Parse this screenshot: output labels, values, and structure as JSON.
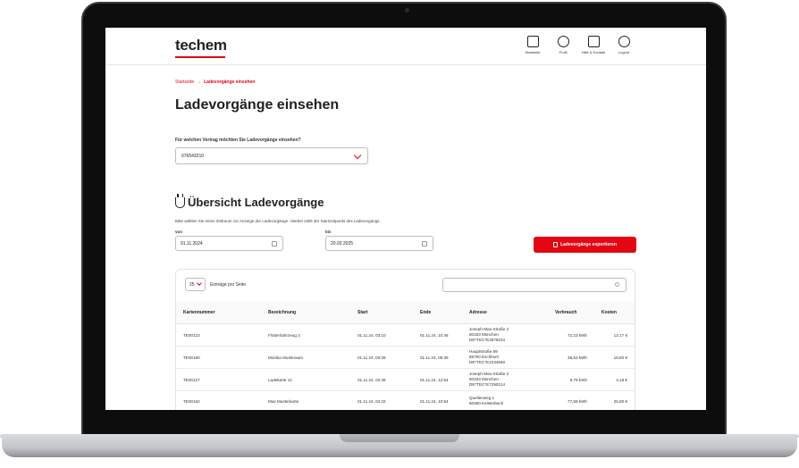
{
  "header": {
    "logo": "techem",
    "nav": [
      {
        "label": "Startseite",
        "icon": "home-icon"
      },
      {
        "label": "Profil",
        "icon": "user-icon"
      },
      {
        "label": "Hilfe & Kontakt",
        "icon": "chat-icon"
      },
      {
        "label": "Logout",
        "icon": "power-icon"
      }
    ]
  },
  "breadcrumb": {
    "home": "Startseite",
    "separator": "→",
    "current": "Ladevorgänge einsehen"
  },
  "page_title": "Ladevorgänge einsehen",
  "contract": {
    "label": "Für welchen Vertrag möchten Sie Ladevorgänge einsehen?",
    "value": "076543210"
  },
  "overview": {
    "title": "Übersicht Ladevorgänge",
    "hint": "Bitte wählen Sie einen Zeitraum zur Anzeige der Ladevorgänge. Hierbei zählt der Startzeitpunkt des Ladevorgangs.",
    "from_label": "von",
    "from_value": "01.11.2024",
    "to_label": "bis",
    "to_value": "20.02.2025",
    "export_label": "Ladevorgänge exportieren"
  },
  "table": {
    "per_page_value": "25",
    "per_page_label": "Einträge pro Seite",
    "search_placeholder": "",
    "columns": [
      "Kartennummer",
      "Bezeichnung",
      "Start",
      "Ende",
      "Adresse",
      "Verbrauch",
      "Kosten"
    ],
    "rows": [
      {
        "card": "TE00123",
        "name": "Flottenfahrzeug 2",
        "start": "01.11.24, 03:10",
        "end": "01.11.24, 10:46",
        "addr1": "Joseph-Max-Straße 2",
        "addr2": "80333 München",
        "addr3": "DE*TEC*E3678234",
        "usage": "72,23 kWh",
        "cost": "12,17 €"
      },
      {
        "card": "TE00180",
        "name": "Monika Musterauto",
        "start": "01.11.24, 03:29",
        "end": "01.11.24, 05:39",
        "addr1": "Hauptstraße 89",
        "addr2": "65760 Eschborn",
        "addr3": "DE*TEC*E1034560",
        "usage": "38,52 kWh",
        "cost": "16,80 €"
      },
      {
        "card": "TE00127",
        "name": "Ladekarte 12",
        "start": "01.11.24, 03:46",
        "end": "01.11.24, 12:54",
        "addr1": "Joseph-Max-Straße 2",
        "addr2": "80333 München",
        "addr3": "DE*TEC*E7290214",
        "usage": "9,76 kWh",
        "cost": "4,18 €"
      },
      {
        "card": "TE00182",
        "name": "Max Musterkarte",
        "start": "01.11.24, 04:22",
        "end": "01.11.24, 10:54",
        "addr1": "Quellenweg 1",
        "addr2": "60360 Kelsterbach",
        "addr3": "",
        "usage": "77,68 kWh",
        "cost": "25,90 €"
      }
    ]
  }
}
